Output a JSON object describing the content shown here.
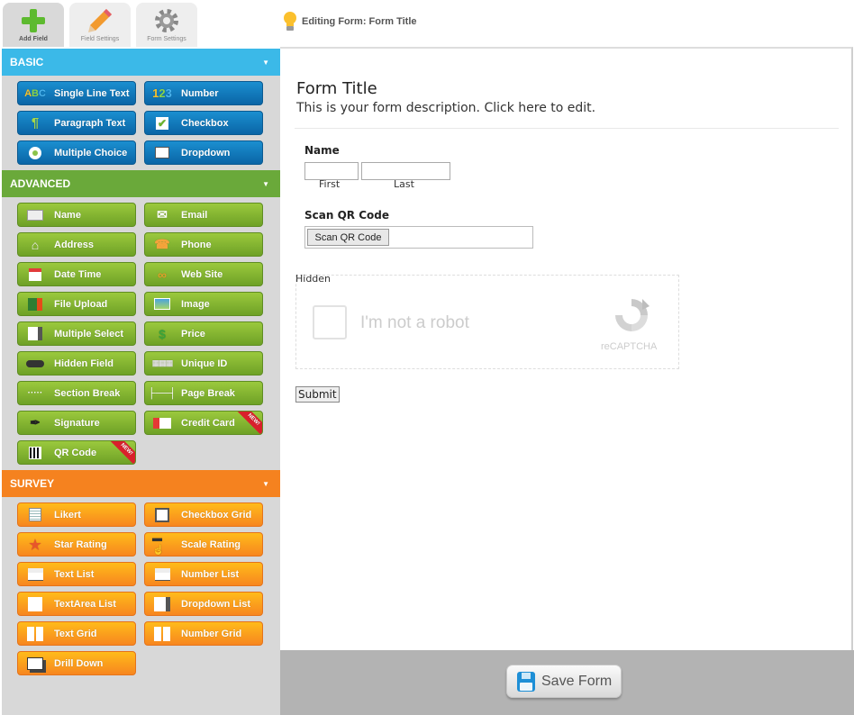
{
  "tabs": [
    {
      "label": "Add Field",
      "icon": "plus-icon",
      "active": true
    },
    {
      "label": "Field Settings",
      "icon": "pencil-icon",
      "active": false
    },
    {
      "label": "Form Settings",
      "icon": "gear-icon",
      "active": false
    }
  ],
  "header": {
    "editing_text": "Editing Form: Form Title"
  },
  "sidebar": {
    "basic": {
      "title": "BASIC",
      "items": [
        {
          "label": "Single Line Text",
          "icon": "abc-icon"
        },
        {
          "label": "Number",
          "icon": "123-icon"
        },
        {
          "label": "Paragraph Text",
          "icon": "paragraph-icon"
        },
        {
          "label": "Checkbox",
          "icon": "checkbox-icon"
        },
        {
          "label": "Multiple Choice",
          "icon": "radio-icon"
        },
        {
          "label": "Dropdown",
          "icon": "dropdown-icon"
        }
      ]
    },
    "advanced": {
      "title": "ADVANCED",
      "items": [
        {
          "label": "Name",
          "icon": "id-card-icon"
        },
        {
          "label": "Email",
          "icon": "envelope-icon"
        },
        {
          "label": "Address",
          "icon": "house-icon"
        },
        {
          "label": "Phone",
          "icon": "phone-icon"
        },
        {
          "label": "Date Time",
          "icon": "calendar-icon"
        },
        {
          "label": "Web Site",
          "icon": "link-icon"
        },
        {
          "label": "File Upload",
          "icon": "upload-icon"
        },
        {
          "label": "Image",
          "icon": "image-icon"
        },
        {
          "label": "Multiple Select",
          "icon": "multi-select-icon"
        },
        {
          "label": "Price",
          "icon": "dollar-icon"
        },
        {
          "label": "Hidden Field",
          "icon": "mask-icon"
        },
        {
          "label": "Unique ID",
          "icon": "id-counter-icon"
        },
        {
          "label": "Section Break",
          "icon": "dotted-line-icon"
        },
        {
          "label": "Page Break",
          "icon": "page-break-icon"
        },
        {
          "label": "Signature",
          "icon": "pen-nib-icon"
        },
        {
          "label": "Credit Card",
          "icon": "credit-card-icon",
          "badge": "NEW!"
        },
        {
          "label": "QR Code",
          "icon": "qr-code-icon",
          "badge": "NEW!"
        }
      ]
    },
    "survey": {
      "title": "SURVEY",
      "items": [
        {
          "label": "Likert",
          "icon": "likert-icon"
        },
        {
          "label": "Checkbox Grid",
          "icon": "checkbox-grid-icon"
        },
        {
          "label": "Star Rating",
          "icon": "star-icon"
        },
        {
          "label": "Scale Rating",
          "icon": "scale-icon"
        },
        {
          "label": "Text List",
          "icon": "text-list-icon"
        },
        {
          "label": "Number List",
          "icon": "number-list-icon"
        },
        {
          "label": "TextArea List",
          "icon": "textarea-list-icon"
        },
        {
          "label": "Dropdown List",
          "icon": "dropdown-list-icon"
        },
        {
          "label": "Text Grid",
          "icon": "text-grid-icon"
        },
        {
          "label": "Number Grid",
          "icon": "number-grid-icon"
        },
        {
          "label": "Drill Down",
          "icon": "drill-down-icon"
        }
      ]
    }
  },
  "form": {
    "title": "Form Title",
    "description": "This is your form description. Click here to edit.",
    "name_field": {
      "label": "Name",
      "first": "First",
      "last": "Last",
      "first_value": "",
      "last_value": ""
    },
    "qr_field": {
      "label": "Scan QR Code",
      "button": "Scan QR Code"
    },
    "hidden_label": "Hidden",
    "captcha": {
      "text": "I'm not a robot",
      "brand": "reCAPTCHA"
    },
    "submit": "Submit"
  },
  "footer": {
    "save_label": "Save Form"
  },
  "colors": {
    "basic": "#3bb9e8",
    "advanced": "#6aa93a",
    "survey": "#f5821f"
  }
}
